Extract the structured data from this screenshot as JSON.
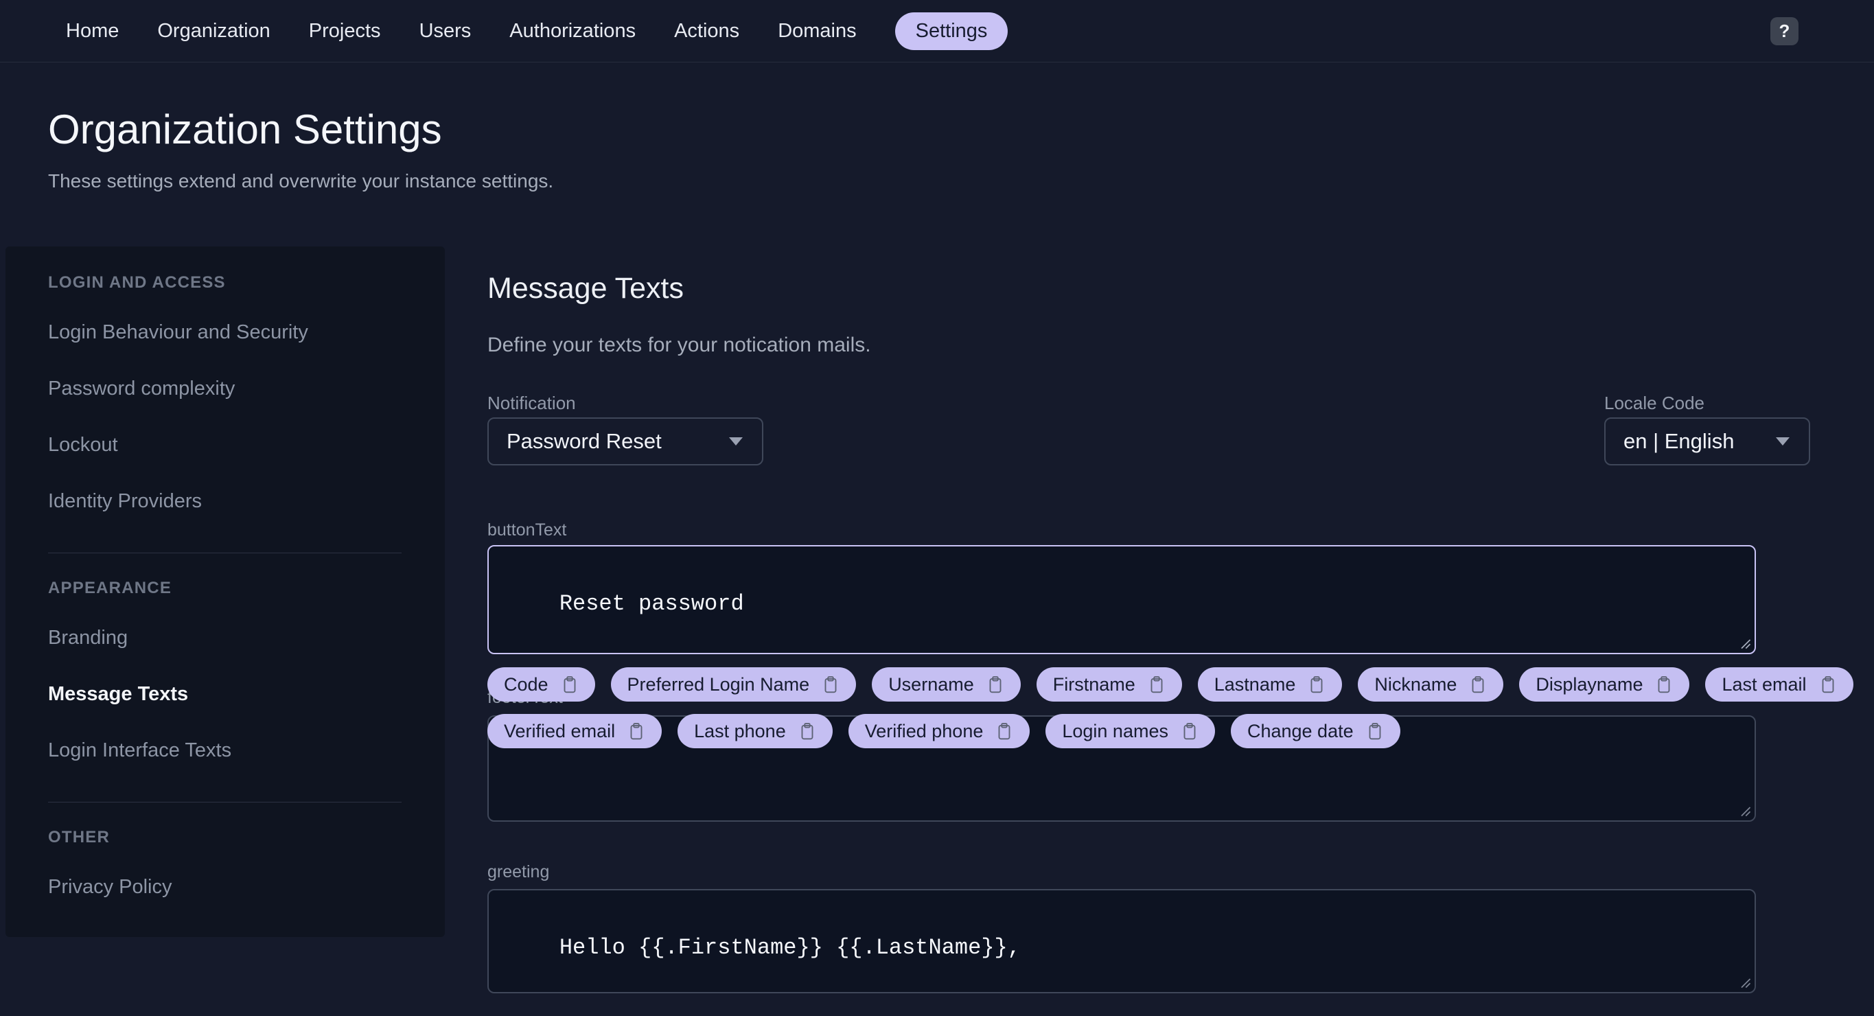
{
  "topnav": {
    "items": [
      "Home",
      "Organization",
      "Projects",
      "Users",
      "Authorizations",
      "Actions",
      "Domains",
      "Settings"
    ],
    "active_item": "Settings",
    "help_label": "?"
  },
  "page_header": {
    "title": "Organization Settings",
    "subtitle": "These settings extend and overwrite your instance settings."
  },
  "sidebar": {
    "sections": [
      {
        "heading": "LOGIN AND ACCESS",
        "items": [
          "Login Behaviour and Security",
          "Password complexity",
          "Lockout",
          "Identity Providers"
        ]
      },
      {
        "heading": "APPEARANCE",
        "items": [
          "Branding",
          "Message Texts",
          "Login Interface Texts"
        ]
      },
      {
        "heading": "OTHER",
        "items": [
          "Privacy Policy"
        ]
      }
    ],
    "active_item": "Message Texts"
  },
  "main": {
    "title": "Message Texts",
    "subtitle": "Define your texts for your notication mails.",
    "notification": {
      "label": "Notification",
      "value": "Password Reset"
    },
    "locale": {
      "label": "Locale Code",
      "value": "en | English"
    },
    "fields": {
      "button_text": {
        "label": "buttonText",
        "value": "Reset password",
        "focused": true
      },
      "footer_text": {
        "label": "footerText",
        "value": ""
      },
      "greeting": {
        "label": "greeting",
        "value": "Hello {{.FirstName}} {{.LastName}},"
      }
    },
    "chips_row1": [
      "Code",
      "Preferred Login Name",
      "Username",
      "Firstname",
      "Lastname",
      "Nickname",
      "Displayname",
      "Last email"
    ],
    "chips_row2": [
      "Verified email",
      "Last phone",
      "Verified phone",
      "Login names",
      "Change date"
    ]
  },
  "icons": {
    "help": "question-mark",
    "caret_down": "triangle-down",
    "clipboard": "clipboard-outline",
    "history": "clock-restore-arrow",
    "undo": "curved-arrow-left",
    "resize_grip": "diagonal-lines"
  },
  "colors": {
    "page_bg": "#151a2b",
    "panel_bg": "#0f1420",
    "field_bg": "#0d1322",
    "accent": "#c5bff2",
    "focus_border": "#c9c3f5",
    "idle_border": "#3f4759",
    "label_gray": "#929aaa"
  }
}
